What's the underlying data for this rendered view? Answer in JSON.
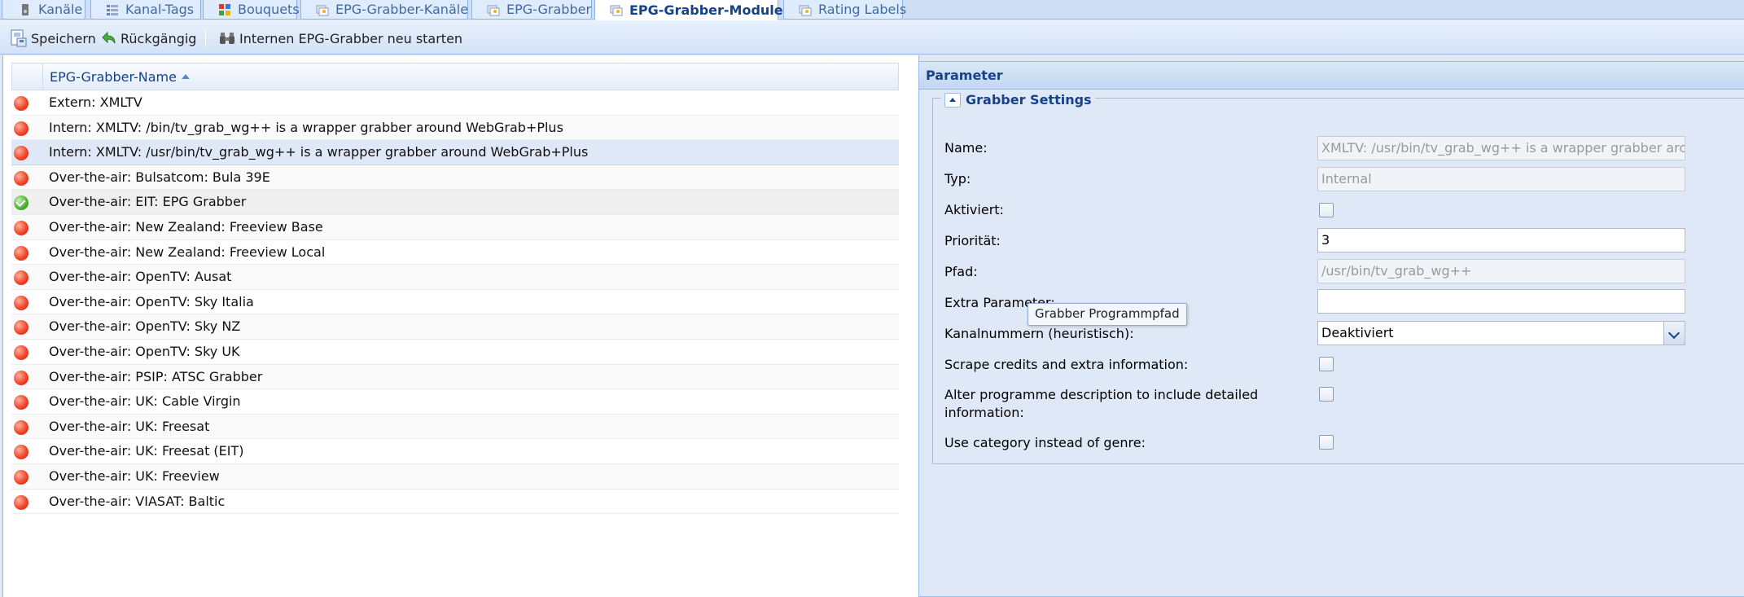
{
  "tabs": [
    {
      "label": "Kanäle",
      "icon": "tv-icon",
      "active": false
    },
    {
      "label": "Kanal-Tags",
      "icon": "tags-icon",
      "active": false
    },
    {
      "label": "Bouquets",
      "icon": "bouquet-icon",
      "active": false
    },
    {
      "label": "EPG-Grabber-Kanäle",
      "icon": "epg-icon",
      "active": false
    },
    {
      "label": "EPG-Grabber",
      "icon": "epg-icon",
      "active": false
    },
    {
      "label": "EPG-Grabber-Module",
      "icon": "epg-icon",
      "active": true
    },
    {
      "label": "Rating Labels",
      "icon": "epg-icon",
      "active": false
    }
  ],
  "toolbar": {
    "save_label": "Speichern",
    "undo_label": "Rückgängig",
    "restart_label": "Internen EPG-Grabber neu starten"
  },
  "grid": {
    "column_header": "EPG-Grabber-Name",
    "rows": [
      {
        "name": "Extern: XMLTV",
        "enabled": false
      },
      {
        "name": "Intern: XMLTV: /bin/tv_grab_wg++ is a wrapper grabber around WebGrab+Plus",
        "enabled": false
      },
      {
        "name": "Intern: XMLTV: /usr/bin/tv_grab_wg++ is a wrapper grabber around WebGrab+Plus",
        "enabled": false,
        "selected": true
      },
      {
        "name": "Over-the-air: Bulsatcom: Bula 39E",
        "enabled": false
      },
      {
        "name": "Over-the-air: EIT: EPG Grabber",
        "enabled": true
      },
      {
        "name": "Over-the-air: New Zealand: Freeview Base",
        "enabled": false
      },
      {
        "name": "Over-the-air: New Zealand: Freeview Local",
        "enabled": false
      },
      {
        "name": "Over-the-air: OpenTV: Ausat",
        "enabled": false
      },
      {
        "name": "Over-the-air: OpenTV: Sky Italia",
        "enabled": false
      },
      {
        "name": "Over-the-air: OpenTV: Sky NZ",
        "enabled": false
      },
      {
        "name": "Over-the-air: OpenTV: Sky UK",
        "enabled": false
      },
      {
        "name": "Over-the-air: PSIP: ATSC Grabber",
        "enabled": false
      },
      {
        "name": "Over-the-air: UK: Cable Virgin",
        "enabled": false
      },
      {
        "name": "Over-the-air: UK: Freesat",
        "enabled": false
      },
      {
        "name": "Over-the-air: UK: Freesat (EIT)",
        "enabled": false
      },
      {
        "name": "Over-the-air: UK: Freeview",
        "enabled": false
      },
      {
        "name": "Over-the-air: VIASAT: Baltic",
        "enabled": false
      }
    ]
  },
  "parameters": {
    "title": "Parameter",
    "fieldset_title": "Grabber Settings",
    "fields": {
      "name_label": "Name:",
      "name_value": "XMLTV: /usr/bin/tv_grab_wg++ is a wrapper grabber around WebGrab+Plus",
      "type_label": "Typ:",
      "type_value": "Internal",
      "enabled_label": "Aktiviert:",
      "priority_label": "Priorität:",
      "priority_value": "3",
      "path_label": "Pfad:",
      "path_value": "/usr/bin/tv_grab_wg++",
      "extra_label": "Extra Parameter:",
      "extra_value": "",
      "channel_numbers_label": "Kanalnummern (heuristisch):",
      "channel_numbers_value": "Deaktiviert",
      "scrape_label": "Scrape credits and extra information:",
      "alter_label": "Alter programme description to include detailed information:",
      "category_label": "Use category instead of genre:"
    },
    "tooltip": "Grabber Programmpfad"
  }
}
